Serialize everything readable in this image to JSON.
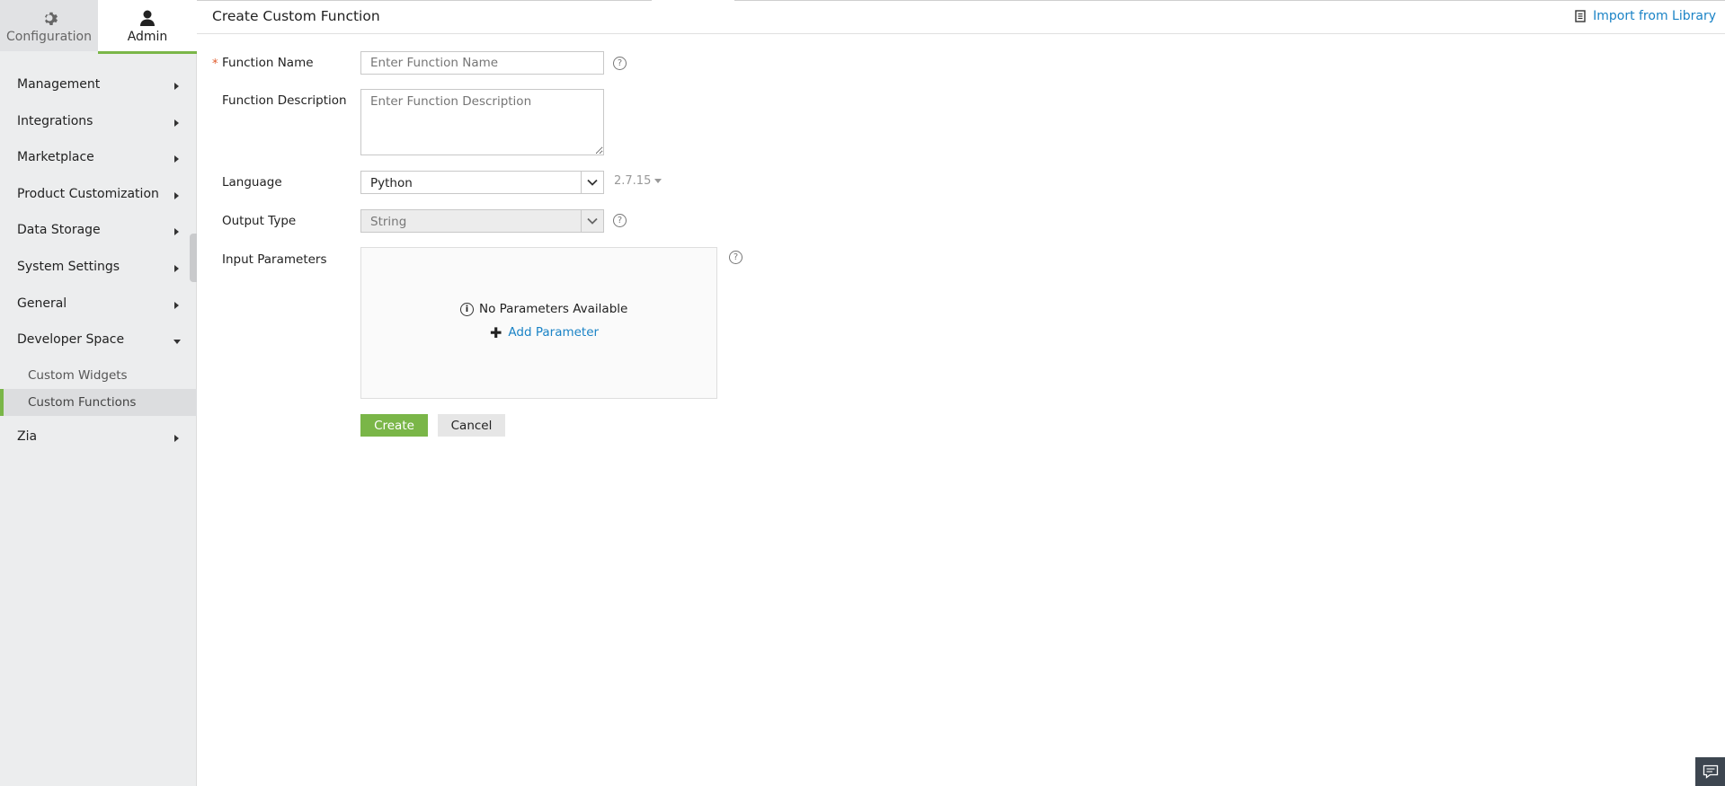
{
  "sidebar": {
    "tabs": [
      {
        "label": "Configuration",
        "icon": "gear-icon"
      },
      {
        "label": "Admin",
        "icon": "user-icon"
      }
    ],
    "menu": [
      {
        "label": "Management"
      },
      {
        "label": "Integrations"
      },
      {
        "label": "Marketplace"
      },
      {
        "label": "Product Customization"
      },
      {
        "label": "Data Storage"
      },
      {
        "label": "System Settings"
      },
      {
        "label": "General"
      },
      {
        "label": "Developer Space",
        "expanded": true,
        "children": [
          {
            "label": "Custom Widgets"
          },
          {
            "label": "Custom Functions",
            "active": true
          }
        ]
      },
      {
        "label": "Zia"
      }
    ]
  },
  "header": {
    "title": "Create Custom Function",
    "import_label": "Import from Library"
  },
  "form": {
    "function_name": {
      "label": "Function Name",
      "required_mark": "*",
      "placeholder": "Enter Function Name"
    },
    "function_description": {
      "label": "Function Description",
      "placeholder": "Enter Function Description"
    },
    "language": {
      "label": "Language",
      "value": "Python",
      "version": "2.7.15"
    },
    "output_type": {
      "label": "Output Type",
      "value": "String"
    },
    "input_parameters": {
      "label": "Input Parameters",
      "empty_text": "No Parameters Available",
      "add_label": "Add Parameter"
    },
    "help_glyph": "?",
    "info_glyph": "i",
    "plus_glyph": "✚"
  },
  "actions": {
    "create_label": "Create",
    "cancel_label": "Cancel"
  },
  "colors": {
    "accent": "#7ab648",
    "link": "#1a83c6"
  }
}
